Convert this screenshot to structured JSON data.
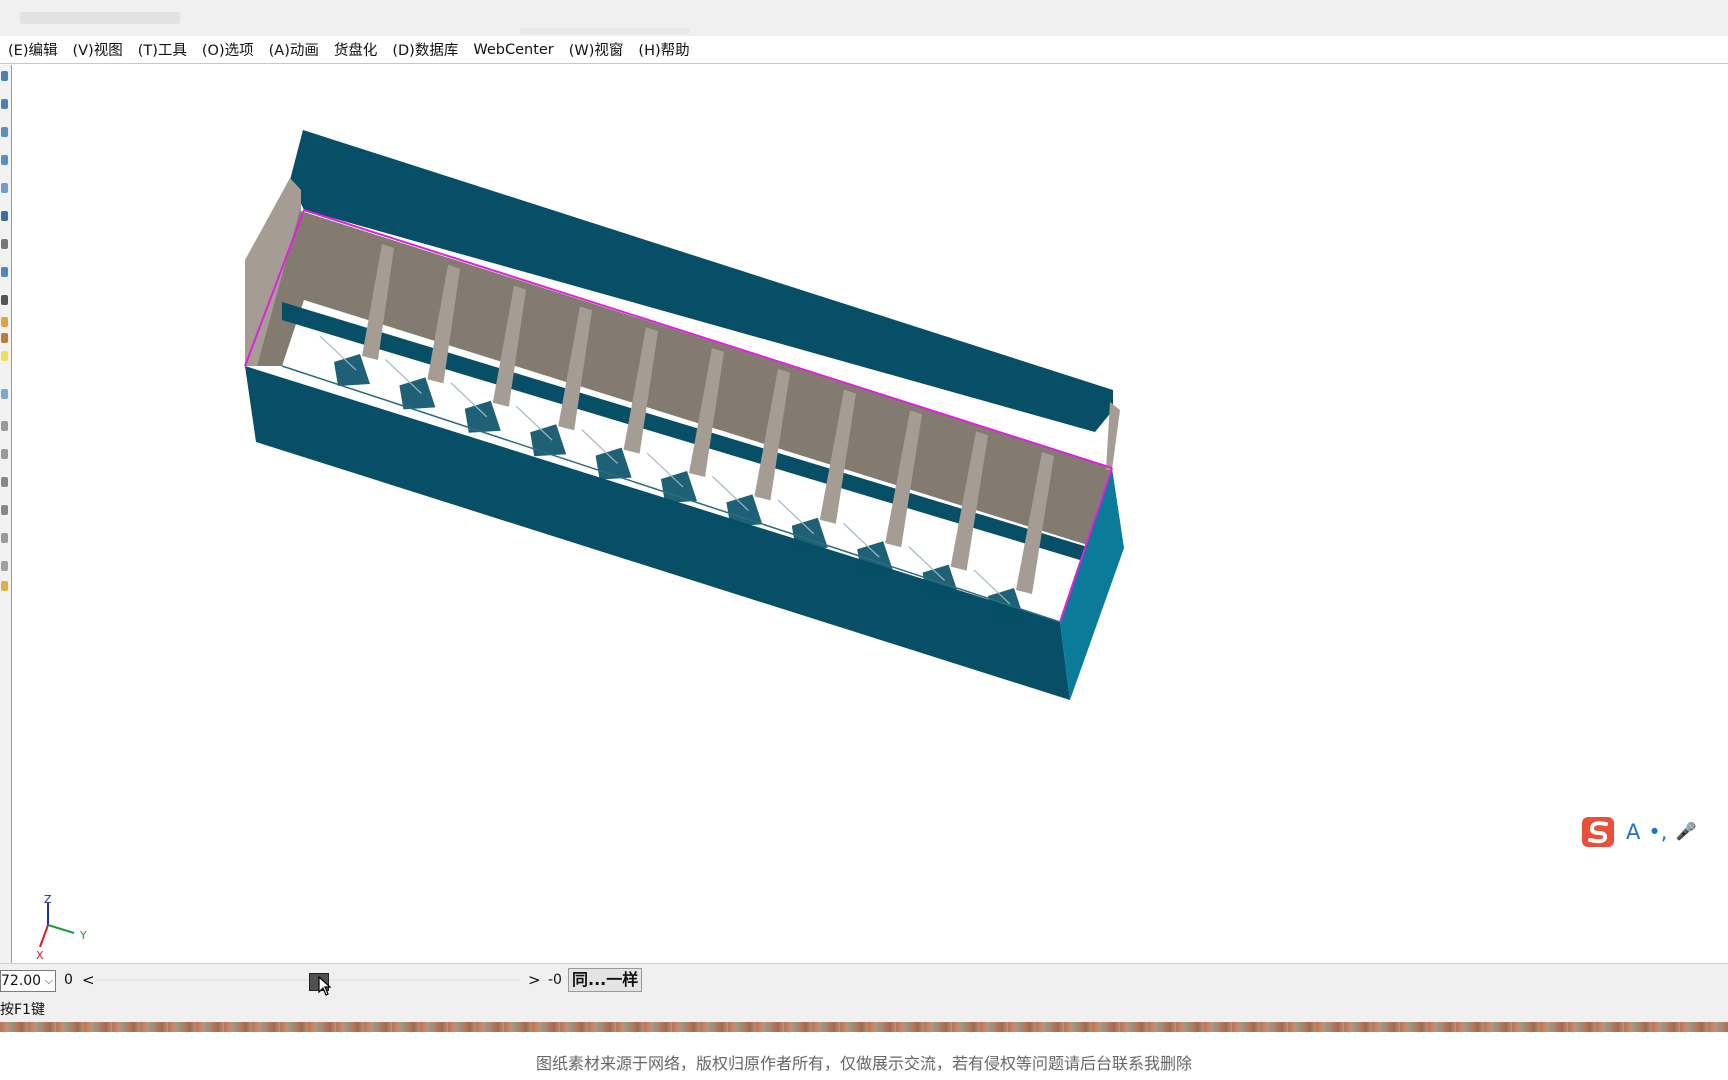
{
  "menu": [
    {
      "label": "(E)编辑"
    },
    {
      "label": "(V)视图"
    },
    {
      "label": "(T)工具"
    },
    {
      "label": "(O)选项"
    },
    {
      "label": "(A)动画"
    },
    {
      "label": "货盘化"
    },
    {
      "label": "(D)数据库"
    },
    {
      "label": "WebCenter"
    },
    {
      "label": "(W)视窗"
    },
    {
      "label": "(H)帮助"
    }
  ],
  "axis": {
    "z_label": "Z",
    "y_label": "Y",
    "x_label": "X"
  },
  "bottom_bar": {
    "zoom_value": "72.00",
    "rotation_value": "0",
    "slider_left_glyph": "<",
    "slider_right_glyph": ">",
    "neg_value": "-0",
    "same_button_label": "同...一样"
  },
  "status": {
    "hint": "按F1键"
  },
  "ime": {
    "glyph_a": "A",
    "glyph_punct": "•,",
    "glyph_mic": "🎤"
  },
  "watermark": "图纸素材来源于网络，版权归原作者所有，仅做展示交流，若有侵权等问题请后台联系我删除",
  "colors": {
    "box_outer": "#064f66",
    "box_side": "#0a7b98",
    "box_inner": "#847b70",
    "box_inner_light": "#a59d93",
    "highlight_edge": "#e020e0",
    "accent_ime": "#e8503a"
  }
}
